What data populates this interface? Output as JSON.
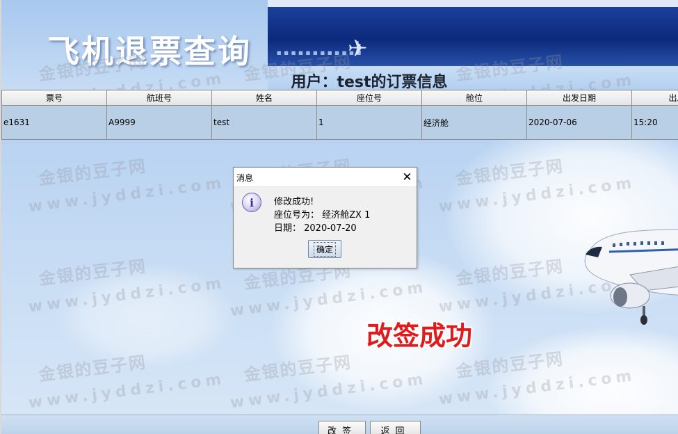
{
  "app": {
    "title": "飞机退票查询",
    "user_heading": "用户：test的订票信息"
  },
  "table": {
    "columns": [
      "票号",
      "航班号",
      "姓名",
      "座位号",
      "舱位",
      "出发日期",
      "出发时间"
    ],
    "rows": [
      [
        "e1631",
        "A9999",
        "test",
        "1",
        "经济舱",
        "2020-07-06",
        "15:20"
      ]
    ]
  },
  "dialog": {
    "title": "消息",
    "icon": "info-icon",
    "lines": [
      "修改成功!",
      "座位号为：  经济舱ZX 1",
      "日期：  2020-07-20"
    ],
    "ok_label": "确定"
  },
  "overlay": {
    "success_label": "改签成功"
  },
  "watermark": {
    "cn": "金银的豆子网",
    "url": "www.jyddzi.com"
  },
  "buttons": {
    "change_label": "改签",
    "back_label": "返回"
  },
  "colors": {
    "header_band": "#0c2a7c",
    "row_bg": "#b8cfe6",
    "success_red": "#e01b1b"
  }
}
